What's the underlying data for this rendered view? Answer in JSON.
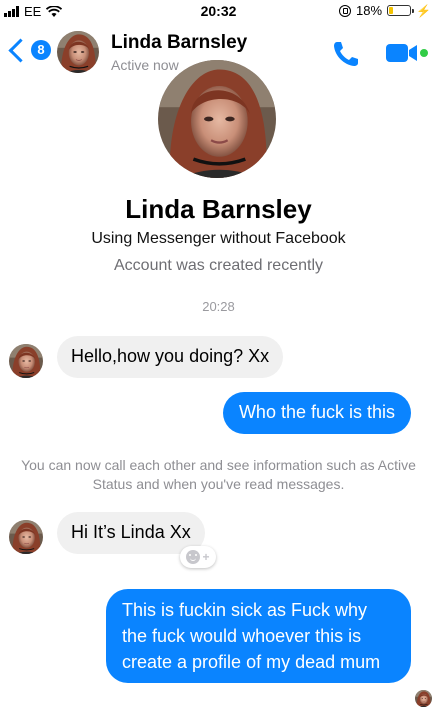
{
  "status_bar": {
    "carrier": "EE",
    "time": "20:32",
    "battery_percent": "18%",
    "battery_level": 0.18,
    "battery_color": "#f5c400",
    "icons": [
      "signal-icon",
      "wifi-icon",
      "rotation-lock-icon",
      "battery-icon",
      "charging-icon"
    ]
  },
  "header": {
    "back_badge": "8",
    "contact_name": "Linda Barnsley",
    "status": "Active now",
    "accent_color": "#0a84ff",
    "icons": [
      "back-chevron-icon",
      "phone-icon",
      "video-camera-icon"
    ]
  },
  "profile": {
    "name": "Linda Barnsley",
    "subtitle": "Using Messenger without Facebook",
    "created_note": "Account was created recently"
  },
  "conversation": {
    "timestamp": "20:28",
    "messages": [
      {
        "from": "contact",
        "text": "Hello,how you doing? Xx"
      },
      {
        "from": "me",
        "text": "Who the fuck is this"
      },
      {
        "from": "contact",
        "text": "Hi It’s Linda Xx"
      },
      {
        "from": "me",
        "text": "This is fuckin sick as Fuck why the fuck would whoever this is create a profile of my dead mum"
      }
    ],
    "notice": "You can now call each other and see information such as Active Status and when you've read messages.",
    "reaction_icon": "add-reaction-icon"
  },
  "colors": {
    "outgoing_bubble": "#0a84ff",
    "incoming_bubble": "#f0f0f0",
    "active_dot": "#31cc46"
  }
}
